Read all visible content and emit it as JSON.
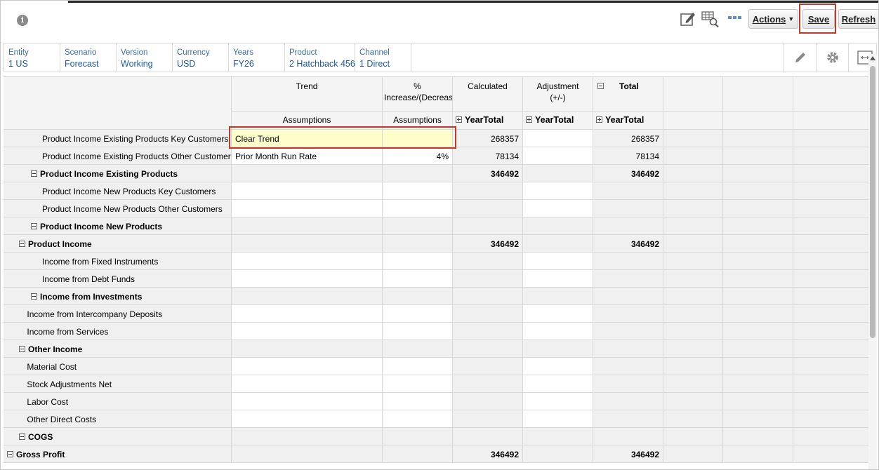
{
  "toolbar": {
    "actions_label": "Actions",
    "save_label": "Save",
    "refresh_label": "Refresh",
    "icons": [
      "info-icon",
      "edit-icon",
      "search-grid-icon",
      "ellipsis-icon"
    ]
  },
  "pov": [
    {
      "label": "Entity",
      "value": "1 US"
    },
    {
      "label": "Scenario",
      "value": "Forecast"
    },
    {
      "label": "Version",
      "value": "Working"
    },
    {
      "label": "Currency",
      "value": "USD"
    },
    {
      "label": "Years",
      "value": "FY26"
    },
    {
      "label": "Product",
      "value": "2 Hatchback 456"
    },
    {
      "label": "Channel",
      "value": "1 Direct"
    }
  ],
  "grid": {
    "columns": [
      {
        "top": "Trend",
        "bottom": "Assumptions"
      },
      {
        "top": "%\nIncrease/(Decrease)",
        "bottom": "Assumptions"
      },
      {
        "top": "Calculated",
        "bottom": "YearTotal"
      },
      {
        "top": "Adjustment\n(+/-)",
        "bottom": "YearTotal"
      },
      {
        "top": "Total",
        "bottom": "YearTotal"
      }
    ],
    "rows": [
      {
        "label": "Product Income Existing Products Key Customers",
        "indent": 2,
        "bold": false,
        "toggle": null,
        "trend": "Clear Trend",
        "pct": "",
        "calc": "268357",
        "adj": "",
        "total": "268357",
        "editable": true
      },
      {
        "label": "Product Income Existing Products Other Customers",
        "indent": 2,
        "bold": false,
        "toggle": null,
        "trend": "Prior Month Run Rate",
        "pct": "4%",
        "calc": "78134",
        "adj": "",
        "total": "78134",
        "editable": true
      },
      {
        "label": "Product Income Existing Products",
        "indent": 1,
        "bold": true,
        "toggle": "minus",
        "trend": "",
        "pct": "",
        "calc": "346492",
        "adj": "",
        "total": "346492",
        "editable": false
      },
      {
        "label": "Product Income New Products Key Customers",
        "indent": 2,
        "bold": false,
        "toggle": null,
        "trend": "",
        "pct": "",
        "calc": "",
        "adj": "",
        "total": "",
        "editable": true
      },
      {
        "label": "Product Income New Products Other Customers",
        "indent": 2,
        "bold": false,
        "toggle": null,
        "trend": "",
        "pct": "",
        "calc": "",
        "adj": "",
        "total": "",
        "editable": true
      },
      {
        "label": "Product Income New Products",
        "indent": 1,
        "bold": true,
        "toggle": "minus",
        "trend": "",
        "pct": "",
        "calc": "",
        "adj": "",
        "total": "",
        "editable": false
      },
      {
        "label": "Product Income",
        "indent": 0.5,
        "bold": true,
        "toggle": "minus",
        "trend": "",
        "pct": "",
        "calc": "346492",
        "adj": "",
        "total": "346492",
        "editable": false
      },
      {
        "label": "Income from Fixed Instruments",
        "indent": 2,
        "bold": false,
        "toggle": null,
        "trend": "",
        "pct": "",
        "calc": "",
        "adj": "",
        "total": "",
        "editable": true
      },
      {
        "label": "Income from Debt Funds",
        "indent": 2,
        "bold": false,
        "toggle": null,
        "trend": "",
        "pct": "",
        "calc": "",
        "adj": "",
        "total": "",
        "editable": true
      },
      {
        "label": "Income from Investments",
        "indent": 1,
        "bold": true,
        "toggle": "minus",
        "trend": "",
        "pct": "",
        "calc": "",
        "adj": "",
        "total": "",
        "editable": false
      },
      {
        "label": "Income from Intercompany Deposits",
        "indent": 1.2,
        "bold": false,
        "toggle": null,
        "trend": "",
        "pct": "",
        "calc": "",
        "adj": "",
        "total": "",
        "editable": true
      },
      {
        "label": "Income from Services",
        "indent": 1.2,
        "bold": false,
        "toggle": null,
        "trend": "",
        "pct": "",
        "calc": "",
        "adj": "",
        "total": "",
        "editable": true
      },
      {
        "label": "Other Income",
        "indent": 0.5,
        "bold": true,
        "toggle": "minus",
        "trend": "",
        "pct": "",
        "calc": "",
        "adj": "",
        "total": "",
        "editable": false
      },
      {
        "label": "Material Cost",
        "indent": 1.2,
        "bold": false,
        "toggle": null,
        "trend": "",
        "pct": "",
        "calc": "",
        "adj": "",
        "total": "",
        "editable": true
      },
      {
        "label": "Stock Adjustments Net",
        "indent": 1.2,
        "bold": false,
        "toggle": null,
        "trend": "",
        "pct": "",
        "calc": "",
        "adj": "",
        "total": "",
        "editable": true
      },
      {
        "label": "Labor Cost",
        "indent": 1.2,
        "bold": false,
        "toggle": null,
        "trend": "",
        "pct": "",
        "calc": "",
        "adj": "",
        "total": "",
        "editable": true
      },
      {
        "label": "Other Direct Costs",
        "indent": 1.2,
        "bold": false,
        "toggle": null,
        "trend": "",
        "pct": "",
        "calc": "",
        "adj": "",
        "total": "",
        "editable": true
      },
      {
        "label": "COGS",
        "indent": 0.5,
        "bold": true,
        "toggle": "minus",
        "trend": "",
        "pct": "",
        "calc": "",
        "adj": "",
        "total": "",
        "editable": false
      },
      {
        "label": "Gross Profit",
        "indent": 0,
        "bold": true,
        "toggle": "minus",
        "trend": "",
        "pct": "",
        "calc": "346492",
        "adj": "",
        "total": "346492",
        "editable": false
      }
    ]
  },
  "colors": {
    "highlight": "#c0392b",
    "selected_cell": "#ffffcc",
    "pov_text": "#1e5aa8"
  }
}
